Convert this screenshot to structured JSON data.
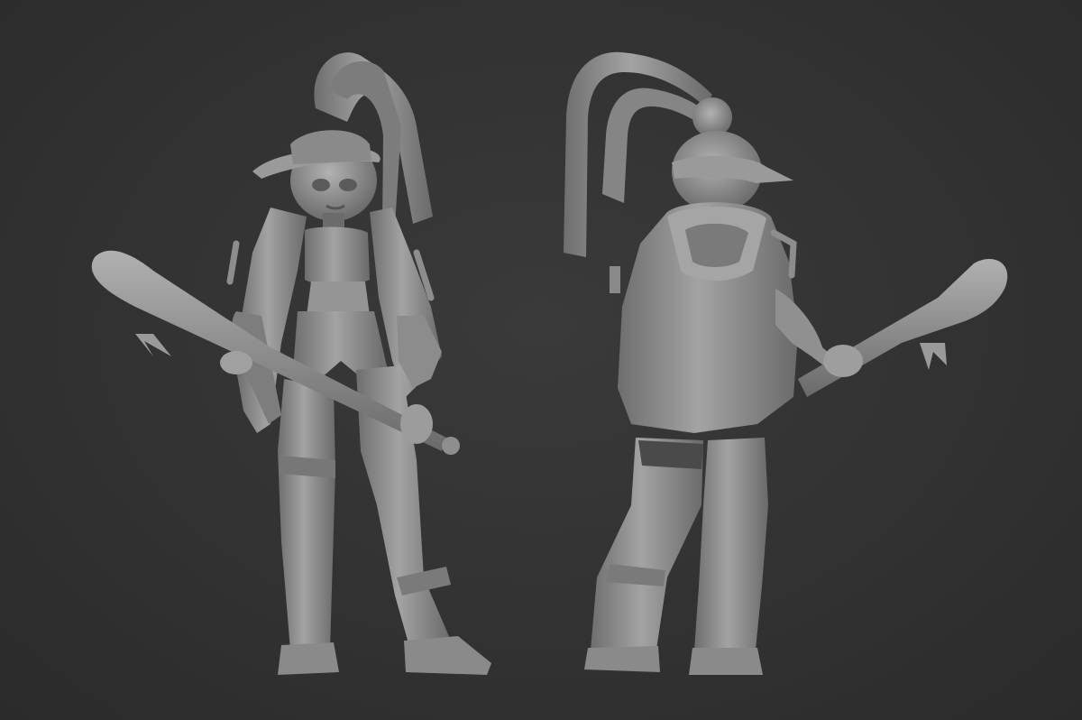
{
  "scene": {
    "background_color": "#313131",
    "model_color": "#8f8f8f",
    "views": [
      {
        "name": "front-view",
        "description_label": ""
      },
      {
        "name": "back-view",
        "description_label": ""
      }
    ]
  }
}
